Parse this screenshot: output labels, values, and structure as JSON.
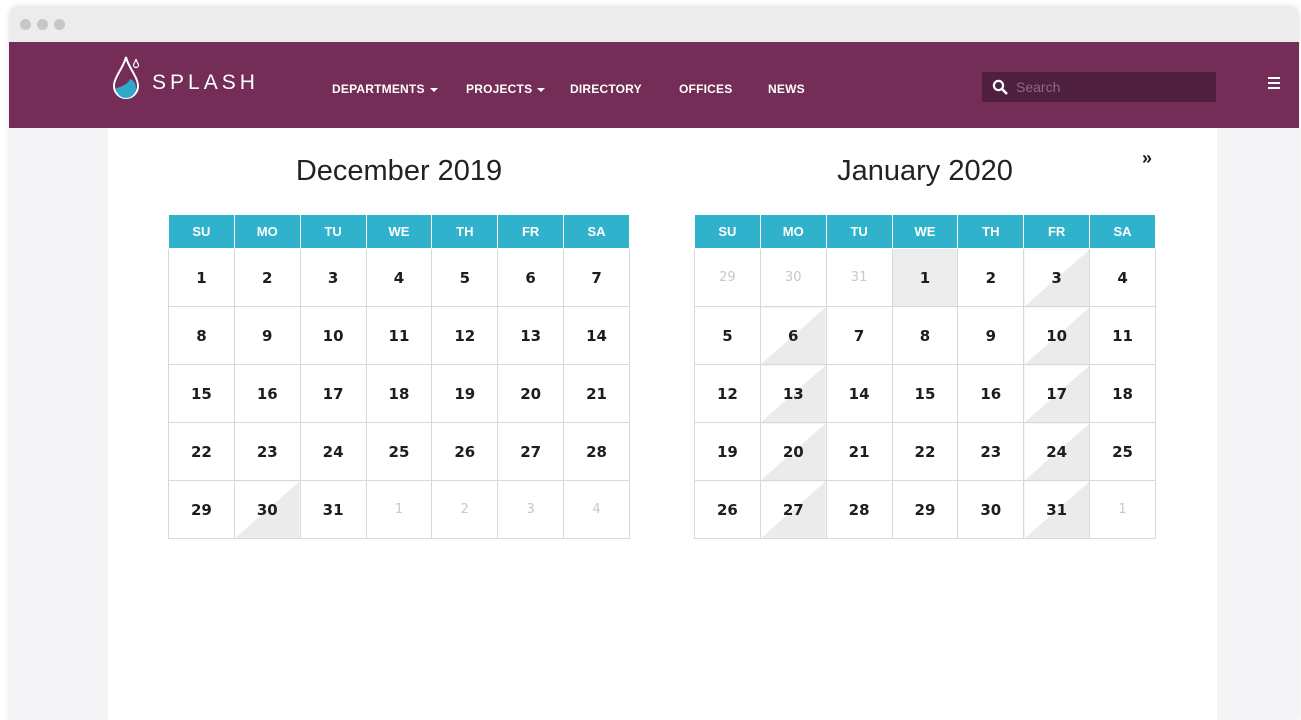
{
  "nav": {
    "brand": "SPLASH",
    "items": [
      "DEPARTMENTS",
      "PROJECTS",
      "DIRECTORY",
      "OFFICES",
      "NEWS"
    ],
    "search_placeholder": "Search",
    "colors": {
      "navbar": "#742d56",
      "search_bg": "#4e1f3e",
      "header_cells": "#30b2cc"
    }
  },
  "next_label": "»",
  "calendars": [
    {
      "title": "December 2019",
      "days": [
        "SU",
        "MO",
        "TU",
        "WE",
        "TH",
        "FR",
        "SA"
      ],
      "weeks": [
        [
          "1",
          "2",
          "3",
          "4",
          "5",
          "6",
          "7"
        ],
        [
          "8",
          "9",
          "10",
          "11",
          "12",
          "13",
          "14"
        ],
        [
          "15",
          "16",
          "17",
          "18",
          "19",
          "20",
          "21"
        ],
        [
          "22",
          "23",
          "24",
          "25",
          "26",
          "27",
          "28"
        ],
        [
          "29",
          "30",
          "31",
          "1",
          "2",
          "3",
          "4"
        ]
      ]
    },
    {
      "title": "January 2020",
      "days": [
        "SU",
        "MO",
        "TU",
        "WE",
        "TH",
        "FR",
        "SA"
      ],
      "weeks": [
        [
          "29",
          "30",
          "31",
          "1",
          "2",
          "3",
          "4"
        ],
        [
          "5",
          "6",
          "7",
          "8",
          "9",
          "10",
          "11"
        ],
        [
          "12",
          "13",
          "14",
          "15",
          "16",
          "17",
          "18"
        ],
        [
          "19",
          "20",
          "21",
          "22",
          "23",
          "24",
          "25"
        ],
        [
          "26",
          "27",
          "28",
          "29",
          "30",
          "31",
          "1"
        ]
      ]
    }
  ]
}
